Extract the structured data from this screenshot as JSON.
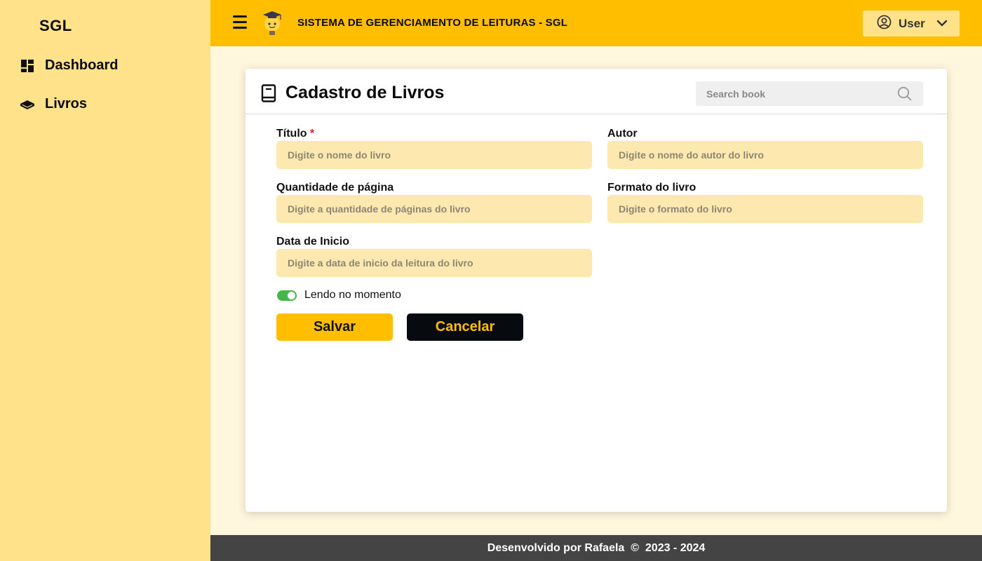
{
  "sidebar": {
    "brand": "SGL",
    "items": [
      {
        "label": "Dashboard",
        "icon": "dashboard-icon"
      },
      {
        "label": "Livros",
        "icon": "book-stack-icon"
      }
    ]
  },
  "header": {
    "title": "SISTEMA DE GERENCIAMENTO DE LEITURAS - SGL",
    "user_label": "User",
    "icons": [
      "menu-icon",
      "lightbulb-mascot-logo",
      "user-circle-icon",
      "chevron-down-icon"
    ]
  },
  "card": {
    "title": "Cadastro de Livros",
    "search_placeholder": "Search book",
    "fields": {
      "titulo": {
        "label": "Título",
        "required_mark": "*",
        "placeholder": "Digite o nome do livro"
      },
      "autor": {
        "label": "Autor",
        "placeholder": "Digite o nome do autor do livro"
      },
      "quantidade": {
        "label": "Quantidade de página",
        "placeholder": "Digite a quantidade de páginas do livro"
      },
      "formato": {
        "label": "Formato do livro",
        "placeholder": "Digite o formato do livro"
      },
      "data_inicio": {
        "label": "Data de Inicio",
        "placeholder": "Digite a data de inicio da leitura do livro"
      }
    },
    "toggle": {
      "label": "Lendo no momento",
      "checked": true
    },
    "buttons": {
      "save": "Salvar",
      "cancel": "Cancelar"
    }
  },
  "footer": {
    "text": "Desenvolvido por Rafaela  ©  2023 - 2024"
  },
  "colors": {
    "sidebar_bg": "#ffe28a",
    "topbar_bg": "#ffbe00",
    "page_bg": "#fff7dd",
    "input_bg": "#fde9b0",
    "toggle_on": "#45b649",
    "footer_bg": "#444444"
  }
}
